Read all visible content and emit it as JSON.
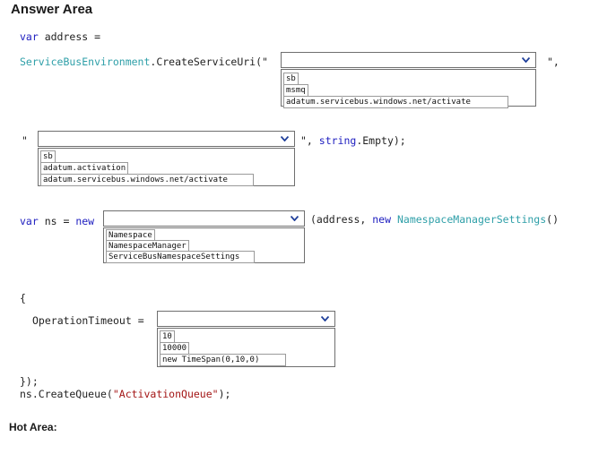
{
  "heading": "Answer Area",
  "footer": "Hot Area:",
  "code": {
    "l1_kw": "var",
    "l1_rest": " address =",
    "l2_type": "ServiceBusEnvironment",
    "l2_rest": ".CreateServiceUri(\"",
    "l2_after": "\",",
    "l3_quote": "\"",
    "l3_after_str": "\", ",
    "l3_member": "string",
    "l3_rest": ".Empty);",
    "l4_kw1": "var",
    "l4_mid": " ns = ",
    "l4_kw2": "new",
    "l4_after1": "(address, ",
    "l4_kw3": "new",
    "l4_sp": " ",
    "l4_type": "NamespaceManagerSettings",
    "l4_end": "()",
    "brace_open": "{",
    "l6_prop": "OperationTimeout =",
    "close": "});",
    "last_a": "ns.CreateQueue(",
    "last_str": "\"ActivationQueue\"",
    "last_b": ");"
  },
  "dropdowns": {
    "dd1": {
      "options": [
        "sb",
        "msmq",
        "adatum.servicebus.windows.net/activate"
      ]
    },
    "dd2": {
      "options": [
        "sb",
        "adatum.activation",
        "adatum.servicebus.windows.net/activate"
      ]
    },
    "dd3": {
      "options": [
        "Namespace",
        "NamespaceManager",
        "ServiceBusNamespaceSettings"
      ]
    },
    "dd4": {
      "options": [
        "10",
        "10000",
        "new TimeSpan(0,10,0)"
      ]
    }
  },
  "colors": {
    "keyword": "#2020c0",
    "type": "#2e9fa8",
    "string": "#a31515",
    "chevron": "#1f3f9a"
  }
}
